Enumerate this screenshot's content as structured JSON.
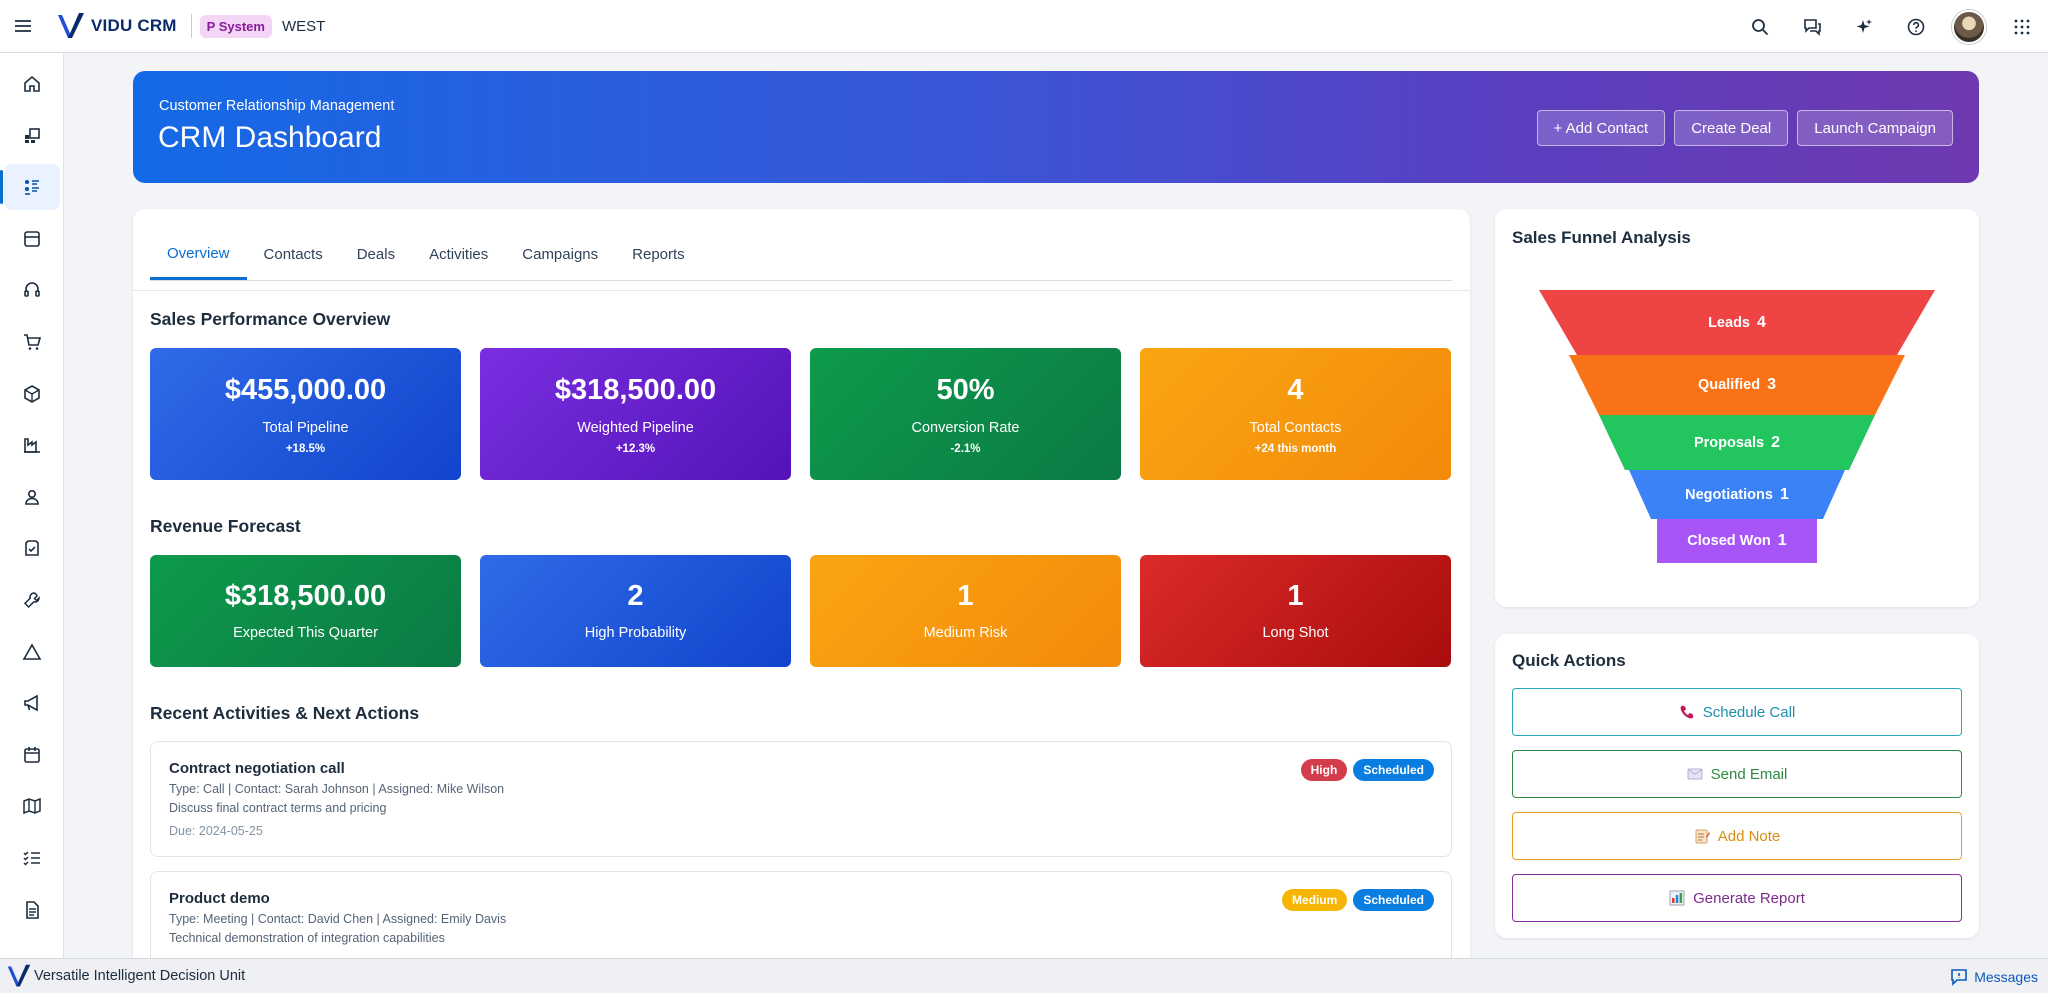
{
  "header": {
    "brand": "VIDU CRM",
    "system_badge": "P System",
    "region": "WEST"
  },
  "hero": {
    "subtitle": "Customer Relationship Management",
    "title": "CRM Dashboard",
    "buttons": [
      "+ Add Contact",
      "Create Deal",
      "Launch Campaign"
    ]
  },
  "tabs": [
    "Overview",
    "Contacts",
    "Deals",
    "Activities",
    "Campaigns",
    "Reports"
  ],
  "sales_performance": {
    "title": "Sales Performance Overview",
    "cards": [
      {
        "value": "$455,000.00",
        "label": "Total Pipeline",
        "change": "+18.5%"
      },
      {
        "value": "$318,500.00",
        "label": "Weighted Pipeline",
        "change": "+12.3%"
      },
      {
        "value": "50%",
        "label": "Conversion Rate",
        "change": "-2.1%"
      },
      {
        "value": "4",
        "label": "Total Contacts",
        "change": "+24 this month"
      }
    ]
  },
  "revenue_forecast": {
    "title": "Revenue Forecast",
    "cards": [
      {
        "value": "$318,500.00",
        "label": "Expected This Quarter"
      },
      {
        "value": "2",
        "label": "High Probability"
      },
      {
        "value": "1",
        "label": "Medium Risk"
      },
      {
        "value": "1",
        "label": "Long Shot"
      }
    ]
  },
  "activities": {
    "title": "Recent Activities & Next Actions",
    "items": [
      {
        "title": "Contract negotiation call",
        "meta": "Type: Call | Contact: Sarah Johnson | Assigned: Mike Wilson",
        "description": "Discuss final contract terms and pricing",
        "due": "Due: 2024-05-25",
        "priority": "High",
        "status": "Scheduled"
      },
      {
        "title": "Product demo",
        "meta": "Type: Meeting | Contact: David Chen | Assigned: Emily Davis",
        "description": "Technical demonstration of integration capabilities",
        "due": "",
        "priority": "Medium",
        "status": "Scheduled"
      }
    ]
  },
  "funnel": {
    "title": "Sales Funnel Analysis",
    "stages": [
      {
        "label": "Leads",
        "count": 4,
        "color": "#ef4444"
      },
      {
        "label": "Qualified",
        "count": 3,
        "color": "#f97316"
      },
      {
        "label": "Proposals",
        "count": 2,
        "color": "#22c55e"
      },
      {
        "label": "Negotiations",
        "count": 1,
        "color": "#3b82f6"
      },
      {
        "label": "Closed Won",
        "count": 1,
        "color": "#a855f7"
      }
    ]
  },
  "quick_actions": {
    "title": "Quick Actions",
    "buttons": [
      "Schedule Call",
      "Send Email",
      "Add Note",
      "Generate Report"
    ]
  },
  "footer": {
    "tagline": "Versatile Intelligent Decision Unit",
    "messages": "Messages"
  }
}
